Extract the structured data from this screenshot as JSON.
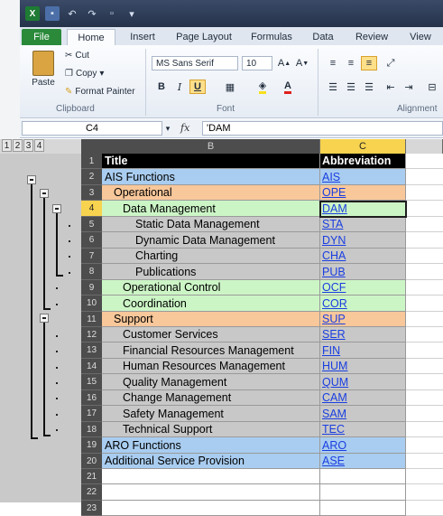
{
  "ribbon": {
    "tabs": [
      "File",
      "Home",
      "Insert",
      "Page Layout",
      "Formulas",
      "Data",
      "Review",
      "View"
    ],
    "clipboard": {
      "paste": "Paste",
      "cut": "Cut",
      "copy": "Copy",
      "copy_arrow": "▾",
      "format_painter": "Format Painter",
      "group_label": "Clipboard"
    },
    "font": {
      "family": "MS Sans Serif",
      "size": "10",
      "group_label": "Font"
    },
    "alignment": {
      "group_label": "Alignment"
    }
  },
  "formula_bar": {
    "name_box": "C4",
    "fx": "fx",
    "value": "'DAM"
  },
  "outline_levels": [
    "1",
    "2",
    "3",
    "4"
  ],
  "columns": {
    "a": "",
    "b": "B",
    "c": "C"
  },
  "rows": [
    {
      "num": "1",
      "title": "Title",
      "abbr": "Abbreviation",
      "indent": 0,
      "bg": "#000000",
      "fg": "#ffffff",
      "bold": true,
      "header": true
    },
    {
      "num": "2",
      "title": "AIS Functions",
      "abbr": "AIS",
      "indent": 0,
      "bg": "#a9cdf0"
    },
    {
      "num": "3",
      "title": "Operational",
      "abbr": "OPE",
      "indent": 10,
      "bg": "#f8c79a"
    },
    {
      "num": "4",
      "title": "Data Management",
      "abbr": "DAM",
      "indent": 20,
      "bg": "#ccf5c6"
    },
    {
      "num": "5",
      "title": "Static Data Management",
      "abbr": "STA",
      "indent": 34,
      "bg": "#c8c8c8"
    },
    {
      "num": "6",
      "title": "Dynamic Data Management",
      "abbr": "DYN",
      "indent": 34,
      "bg": "#c8c8c8"
    },
    {
      "num": "7",
      "title": "Charting",
      "abbr": "CHA",
      "indent": 34,
      "bg": "#c8c8c8"
    },
    {
      "num": "8",
      "title": "Publications",
      "abbr": "PUB",
      "indent": 34,
      "bg": "#c8c8c8"
    },
    {
      "num": "9",
      "title": "Operational Control",
      "abbr": "OCF",
      "indent": 20,
      "bg": "#ccf5c6"
    },
    {
      "num": "10",
      "title": "Coordination",
      "abbr": "COR",
      "indent": 20,
      "bg": "#ccf5c6"
    },
    {
      "num": "11",
      "title": "Support",
      "abbr": "SUP",
      "indent": 10,
      "bg": "#f8c79a"
    },
    {
      "num": "12",
      "title": "Customer Services",
      "abbr": "SER",
      "indent": 20,
      "bg": "#c8c8c8"
    },
    {
      "num": "13",
      "title": "Financial Resources Management",
      "abbr": "FIN",
      "indent": 20,
      "bg": "#c8c8c8"
    },
    {
      "num": "14",
      "title": "Human Resources Management",
      "abbr": "HUM",
      "indent": 20,
      "bg": "#c8c8c8"
    },
    {
      "num": "15",
      "title": "Quality Management",
      "abbr": "QUM",
      "indent": 20,
      "bg": "#c8c8c8"
    },
    {
      "num": "16",
      "title": "Change Management",
      "abbr": "CAM",
      "indent": 20,
      "bg": "#c8c8c8"
    },
    {
      "num": "17",
      "title": "Safety Management",
      "abbr": "SAM",
      "indent": 20,
      "bg": "#c8c8c8"
    },
    {
      "num": "18",
      "title": "Technical Support",
      "abbr": "TEC",
      "indent": 20,
      "bg": "#c8c8c8"
    },
    {
      "num": "19",
      "title": "ARO Functions",
      "abbr": "ARO",
      "indent": 0,
      "bg": "#a9cdf0"
    },
    {
      "num": "20",
      "title": "Additional Service Provision",
      "abbr": "ASE",
      "indent": 0,
      "bg": "#a9cdf0"
    },
    {
      "num": "21",
      "title": "",
      "abbr": "",
      "indent": 0,
      "bg": "#ffffff"
    },
    {
      "num": "22",
      "title": "",
      "abbr": "",
      "indent": 0,
      "bg": "#ffffff"
    },
    {
      "num": "23",
      "title": "",
      "abbr": "",
      "indent": 0,
      "bg": "#ffffff"
    }
  ],
  "selected_cell": "C4",
  "colors": {
    "accent_selected_header": "#f7d34f",
    "link_blue": "#1a3ee0"
  }
}
